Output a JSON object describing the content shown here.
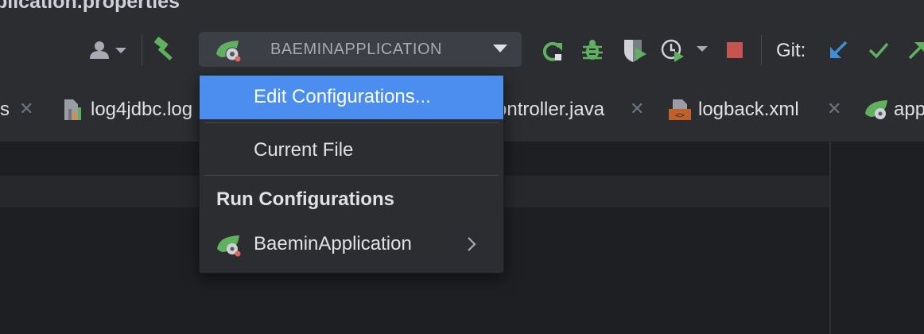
{
  "window": {
    "title": "plication.properties"
  },
  "toolbar": {
    "run_config_name": "BAEMINAPPLICATION",
    "git_label": "Git:",
    "icons": [
      "user-icon",
      "hammer-icon",
      "spring-boot-icon",
      "dropdown-arrow-icon",
      "rerun-icon",
      "debug-icon",
      "coverage-icon",
      "profile-icon",
      "stop-icon",
      "git-update-icon",
      "git-commit-icon",
      "git-push-icon"
    ]
  },
  "tabs": [
    {
      "label": "s",
      "icon": "properties-icon"
    },
    {
      "label": "log4jdbc.log",
      "icon": "log-file-icon"
    },
    {
      "label": "ontroller.java",
      "icon": "java-file-icon"
    },
    {
      "label": "logback.xml",
      "icon": "xml-file-icon"
    },
    {
      "label": "app",
      "icon": "spring-file-icon"
    }
  ],
  "popup": {
    "edit_configurations": "Edit Configurations...",
    "current_file": "Current File",
    "run_configurations_header": "Run Configurations",
    "run_configs": [
      {
        "label": "BaeminApplication"
      }
    ]
  },
  "colors": {
    "background": "#2b2d30",
    "editor": "#1e1f22",
    "selection": "#4b8ef0",
    "accent_green": "#5fb05f",
    "stop_red": "#c75450",
    "git_blue": "#3d8fd6"
  }
}
